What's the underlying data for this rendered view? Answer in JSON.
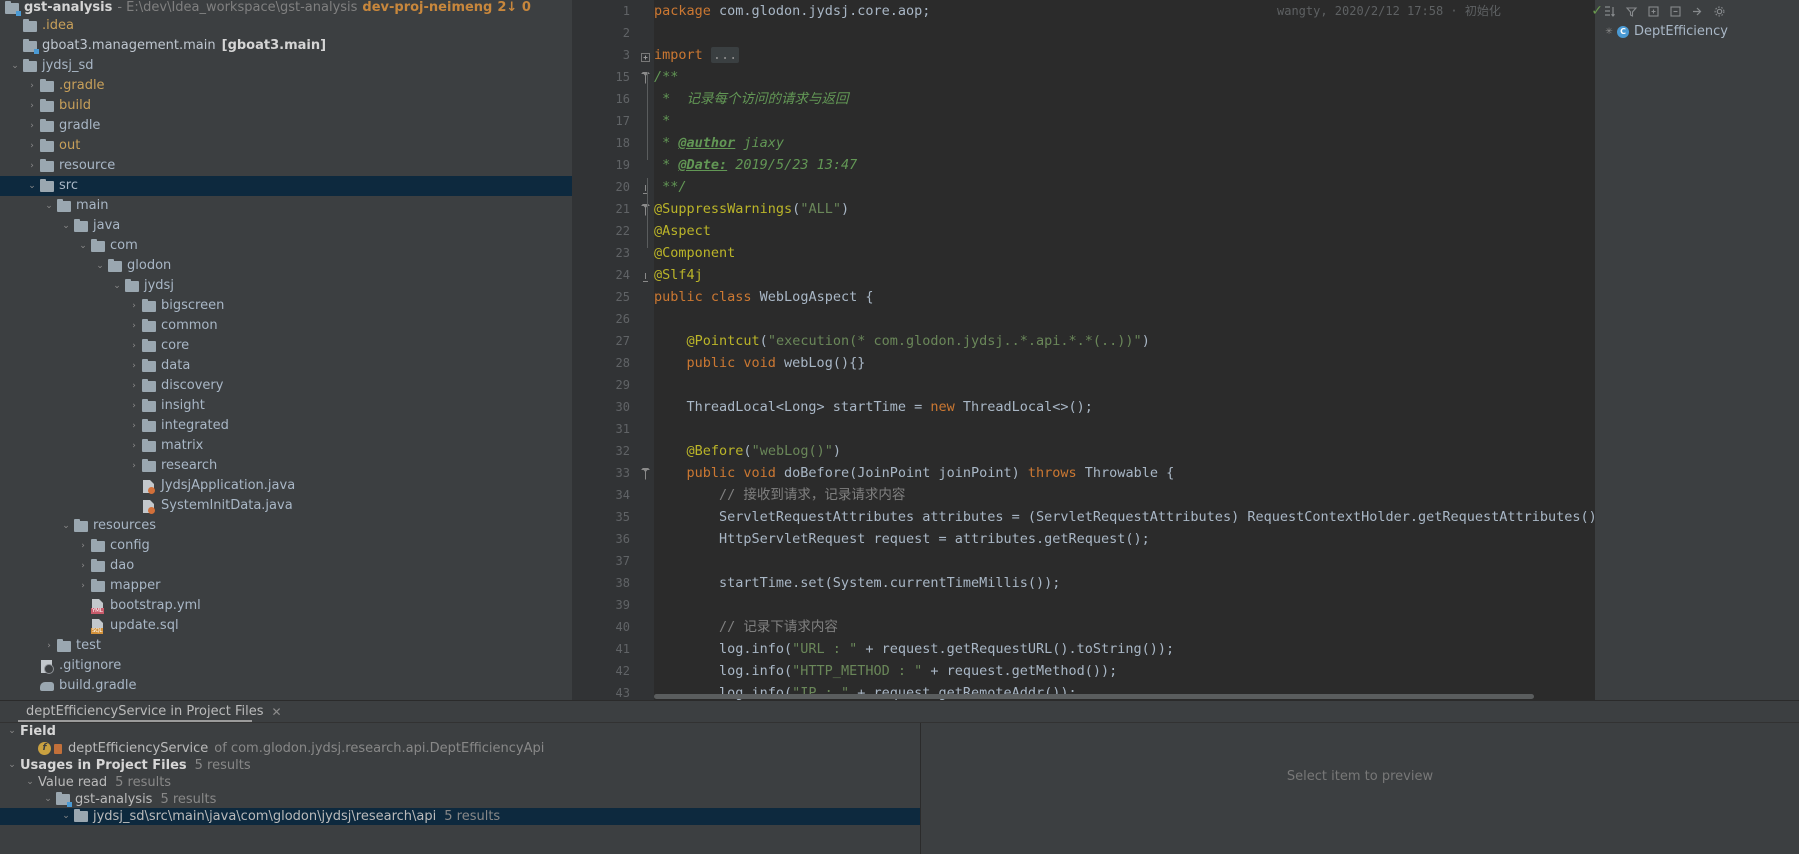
{
  "window": {
    "project_name": "gst-analysis",
    "project_path": "- E:\\dev\\Idea_workspace\\gst-analysis",
    "branch": "dev-proj-neimeng",
    "vcs_counts": "2↓ 0"
  },
  "project_tree": [
    {
      "indent": 0,
      "arrow": "",
      "icon": "folder",
      "label": ".idea",
      "style": "excl"
    },
    {
      "indent": 0,
      "arrow": "",
      "icon": "module",
      "label": "gboat3.management.main",
      "suffix": "[gboat3.main]"
    },
    {
      "indent": 0,
      "arrow": "down",
      "icon": "folder",
      "label": "jydsj_sd"
    },
    {
      "indent": 1,
      "arrow": "right",
      "icon": "folder",
      "label": ".gradle",
      "style": "excl"
    },
    {
      "indent": 1,
      "arrow": "right",
      "icon": "folder",
      "label": "build",
      "style": "excl"
    },
    {
      "indent": 1,
      "arrow": "right",
      "icon": "folder",
      "label": "gradle"
    },
    {
      "indent": 1,
      "arrow": "right",
      "icon": "folder",
      "label": "out",
      "style": "excl"
    },
    {
      "indent": 1,
      "arrow": "right",
      "icon": "folder",
      "label": "resource"
    },
    {
      "indent": 1,
      "arrow": "down",
      "icon": "folder",
      "label": "src",
      "selected": true
    },
    {
      "indent": 2,
      "arrow": "down",
      "icon": "folder",
      "label": "main"
    },
    {
      "indent": 3,
      "arrow": "down",
      "icon": "folder",
      "label": "java"
    },
    {
      "indent": 4,
      "arrow": "down",
      "icon": "folder",
      "label": "com"
    },
    {
      "indent": 5,
      "arrow": "down",
      "icon": "folder",
      "label": "glodon"
    },
    {
      "indent": 6,
      "arrow": "down",
      "icon": "folder",
      "label": "jydsj"
    },
    {
      "indent": 7,
      "arrow": "right",
      "icon": "folder",
      "label": "bigscreen"
    },
    {
      "indent": 7,
      "arrow": "right",
      "icon": "folder",
      "label": "common"
    },
    {
      "indent": 7,
      "arrow": "right",
      "icon": "folder",
      "label": "core"
    },
    {
      "indent": 7,
      "arrow": "right",
      "icon": "folder",
      "label": "data"
    },
    {
      "indent": 7,
      "arrow": "right",
      "icon": "folder",
      "label": "discovery"
    },
    {
      "indent": 7,
      "arrow": "right",
      "icon": "folder",
      "label": "insight"
    },
    {
      "indent": 7,
      "arrow": "right",
      "icon": "folder",
      "label": "integrated"
    },
    {
      "indent": 7,
      "arrow": "right",
      "icon": "folder",
      "label": "matrix"
    },
    {
      "indent": 7,
      "arrow": "right",
      "icon": "folder",
      "label": "research"
    },
    {
      "indent": 7,
      "arrow": "",
      "icon": "java",
      "label": "JydsjApplication.java"
    },
    {
      "indent": 7,
      "arrow": "",
      "icon": "java",
      "label": "SystemInitData.java"
    },
    {
      "indent": 3,
      "arrow": "down",
      "icon": "folder",
      "label": "resources"
    },
    {
      "indent": 4,
      "arrow": "right",
      "icon": "folder",
      "label": "config"
    },
    {
      "indent": 4,
      "arrow": "right",
      "icon": "folder",
      "label": "dao"
    },
    {
      "indent": 4,
      "arrow": "right",
      "icon": "folder",
      "label": "mapper"
    },
    {
      "indent": 4,
      "arrow": "",
      "icon": "yml",
      "label": "bootstrap.yml"
    },
    {
      "indent": 4,
      "arrow": "",
      "icon": "sql",
      "label": "update.sql"
    },
    {
      "indent": 2,
      "arrow": "right",
      "icon": "folder",
      "label": "test"
    },
    {
      "indent": 1,
      "arrow": "",
      "icon": "gitignore",
      "label": ".gitignore"
    },
    {
      "indent": 1,
      "arrow": "",
      "icon": "gradle",
      "label": "build.gradle"
    }
  ],
  "editor": {
    "header_comment": "wangty, 2020/2/12 17:58 · 初始化",
    "lines": [
      {
        "no": "1",
        "html": "<span class=\"kw\">package</span> com.glodon.jydsj.core.aop;"
      },
      {
        "no": "2",
        "html": ""
      },
      {
        "no": "3",
        "html": "<span class=\"kw\">import</span> <span class=\"folded\">...</span>",
        "fold": "plus"
      },
      {
        "no": "15",
        "html": "<span class=\"cmt\">/**</span>",
        "fold": "minus"
      },
      {
        "no": "16",
        "html": "<span class=\"cmt\"> *  记录每个访问的请求与返回</span>"
      },
      {
        "no": "17",
        "html": "<span class=\"cmt\"> *</span>"
      },
      {
        "no": "18",
        "html": "<span class=\"cmt\"> * <span class=\"tag\">@author</span> jiaxy</span>"
      },
      {
        "no": "19",
        "html": "<span class=\"cmt\"> * <span class=\"tag\">@Date:</span> 2019/5/23 13:47</span>"
      },
      {
        "no": "20",
        "html": "<span class=\"cmt\"> **/</span>",
        "fold": "end"
      },
      {
        "no": "21",
        "html": "<span class=\"ann\">@SuppressWarnings</span>(<span class=\"str\">\"ALL\"</span>)",
        "fold": "minus"
      },
      {
        "no": "22",
        "html": "<span class=\"ann\">@Aspect</span>"
      },
      {
        "no": "23",
        "html": "<span class=\"ann\">@Component</span>"
      },
      {
        "no": "24",
        "html": "<span class=\"ann\">@Slf4j</span>",
        "fold": "end"
      },
      {
        "no": "25",
        "html": "<span class=\"kw\">public class</span> WebLogAspect {"
      },
      {
        "no": "26",
        "html": ""
      },
      {
        "no": "27",
        "html": "    <span class=\"ann\">@Pointcut</span>(<span class=\"str\">\"execution(* com.glodon.jydsj..*.api.*.*(..))\"</span>)"
      },
      {
        "no": "28",
        "html": "    <span class=\"kw\">public void</span> webLog(){}"
      },
      {
        "no": "29",
        "html": ""
      },
      {
        "no": "30",
        "html": "    ThreadLocal&lt;Long&gt; startTime = <span class=\"kw\">new</span> ThreadLocal&lt;&gt;();"
      },
      {
        "no": "31",
        "html": ""
      },
      {
        "no": "32",
        "html": "    <span class=\"ann\">@Before</span>(<span class=\"str\">\"webLog()\"</span>)"
      },
      {
        "no": "33",
        "html": "    <span class=\"kw\">public void</span> doBefore(JoinPoint joinPoint) <span class=\"kw\">throws</span> Throwable {",
        "fold": "minus"
      },
      {
        "no": "34",
        "html": "        <span class=\"cmt2\">// 接收到请求，记录请求内容</span>"
      },
      {
        "no": "35",
        "html": "        ServletRequestAttributes attributes = (ServletRequestAttributes) RequestContextHolder.getRequestAttributes();"
      },
      {
        "no": "36",
        "html": "        HttpServletRequest request = attributes.getRequest();"
      },
      {
        "no": "37",
        "html": ""
      },
      {
        "no": "38",
        "html": "        startTime.set(System.currentTimeMillis());"
      },
      {
        "no": "39",
        "html": ""
      },
      {
        "no": "40",
        "html": "        <span class=\"cmt2\">// 记录下请求内容</span>"
      },
      {
        "no": "41",
        "html": "        log.info(<span class=\"str\">\"URL : \"</span> + request.getRequestURL().toString());"
      },
      {
        "no": "42",
        "html": "        log.info(<span class=\"str\">\"HTTP_METHOD : \"</span> + request.getMethod());"
      },
      {
        "no": "43",
        "html": "        log.info(<span class=\"str\">\"IP : \"</span> + request.getRemoteAddr());"
      }
    ]
  },
  "structure_panel": {
    "item_label": "DeptEfficiency"
  },
  "usages": {
    "tab_title": "deptEfficiencyService in Project Files",
    "close_label": "✕",
    "rows": [
      {
        "indent": 0,
        "arrow": "down",
        "label": "Field",
        "bold": true
      },
      {
        "indent": 1,
        "arrow": "none",
        "icon": "field",
        "label": "deptEfficiencyService",
        "of": "of com.glodon.jydsj.research.api.DeptEfficiencyApi"
      },
      {
        "indent": 0,
        "arrow": "down",
        "label": "Usages in Project Files",
        "bold": true,
        "count": "5 results"
      },
      {
        "indent": 1,
        "arrow": "down",
        "label": "Value read",
        "count": "5 results"
      },
      {
        "indent": 2,
        "arrow": "down",
        "icon": "module",
        "label": "gst-analysis",
        "count": "5 results"
      },
      {
        "indent": 3,
        "arrow": "down",
        "icon": "folder",
        "label": "jydsj_sd\\src\\main\\java\\com\\glodon\\jydsj\\research\\api",
        "count": "5 results",
        "selected": true
      }
    ],
    "preview_placeholder": "Select item to preview"
  },
  "colors": {
    "bg_panel": "#3c3f41",
    "bg_editor": "#2b2b2b",
    "selection": "#0d293e",
    "text": "#a9b7c6",
    "keyword": "#cc7832",
    "string": "#6a8759",
    "comment": "#629755",
    "annotation": "#bbb529",
    "excluded": "#c8a05a"
  }
}
